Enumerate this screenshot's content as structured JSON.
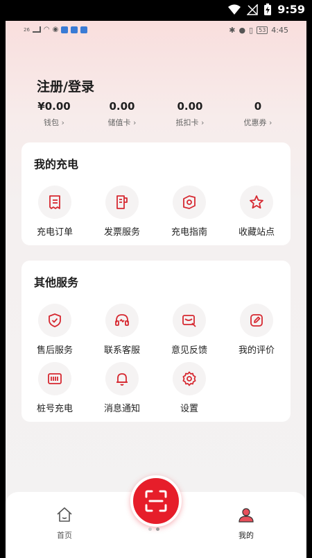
{
  "device_status": {
    "time": "9:59"
  },
  "inner_status": {
    "left_signal": "26",
    "battery": "53",
    "time": "4:45"
  },
  "user": {
    "title": "注册/登录"
  },
  "stats": [
    {
      "value": "¥0.00",
      "label": "钱包"
    },
    {
      "value": "0.00",
      "label": "储值卡"
    },
    {
      "value": "0.00",
      "label": "抵扣卡"
    },
    {
      "value": "0",
      "label": "优惠券"
    }
  ],
  "my_charging": {
    "title": "我的充电",
    "items": [
      {
        "label": "充电订单",
        "icon": "receipt-icon"
      },
      {
        "label": "发票服务",
        "icon": "invoice-icon"
      },
      {
        "label": "充电指南",
        "icon": "guide-icon"
      },
      {
        "label": "收藏站点",
        "icon": "star-icon"
      }
    ]
  },
  "other_services": {
    "title": "其他服务",
    "items": [
      {
        "label": "售后服务",
        "icon": "shield-check-icon"
      },
      {
        "label": "联系客服",
        "icon": "headset-icon"
      },
      {
        "label": "意见反馈",
        "icon": "feedback-icon"
      },
      {
        "label": "我的评价",
        "icon": "edit-icon"
      },
      {
        "label": "桩号充电",
        "icon": "barcode-icon"
      },
      {
        "label": "消息通知",
        "icon": "bell-icon"
      },
      {
        "label": "设置",
        "icon": "gear-icon"
      }
    ]
  },
  "bottom_nav": {
    "home_label": "首页",
    "mine_label": "我的"
  },
  "colors": {
    "accent": "#e61e2a",
    "icon_stroke": "#d62830"
  }
}
